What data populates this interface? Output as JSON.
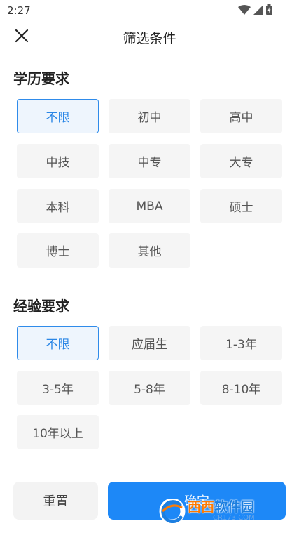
{
  "status_bar": {
    "time": "2:27"
  },
  "header": {
    "title": "筛选条件"
  },
  "education": {
    "title": "学历要求",
    "options": [
      {
        "label": "不限",
        "selected": true
      },
      {
        "label": "初中",
        "selected": false
      },
      {
        "label": "高中",
        "selected": false
      },
      {
        "label": "中技",
        "selected": false
      },
      {
        "label": "中专",
        "selected": false
      },
      {
        "label": "大专",
        "selected": false
      },
      {
        "label": "本科",
        "selected": false
      },
      {
        "label": "MBA",
        "selected": false
      },
      {
        "label": "硕士",
        "selected": false
      },
      {
        "label": "博士",
        "selected": false
      },
      {
        "label": "其他",
        "selected": false
      }
    ]
  },
  "experience": {
    "title": "经验要求",
    "options": [
      {
        "label": "不限",
        "selected": true
      },
      {
        "label": "应届生",
        "selected": false
      },
      {
        "label": "1-3年",
        "selected": false
      },
      {
        "label": "3-5年",
        "selected": false
      },
      {
        "label": "5-8年",
        "selected": false
      },
      {
        "label": "8-10年",
        "selected": false
      },
      {
        "label": "10年以上",
        "selected": false
      }
    ]
  },
  "footer": {
    "reset_label": "重置",
    "confirm_label": "确定"
  },
  "watermark": {
    "main_orange": "西西",
    "main_blue": "软件园",
    "sub": "CR173.COM"
  },
  "colors": {
    "accent": "#1d88f7",
    "selected_border": "#2f8bea",
    "selected_bg": "#eef5fd",
    "option_bg": "#f5f5f5"
  }
}
